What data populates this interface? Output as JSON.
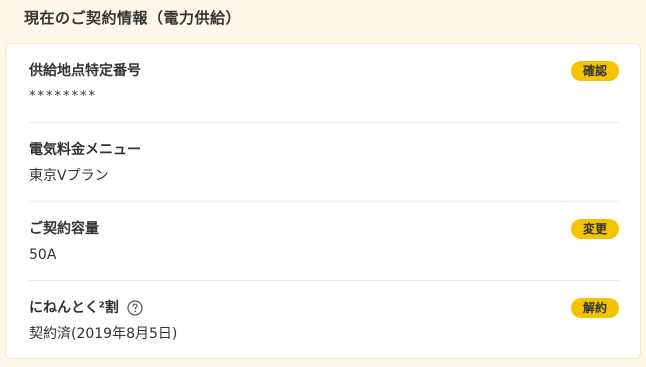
{
  "page": {
    "title": "現在のご契約情報（電力供給）"
  },
  "contract": {
    "supply_point": {
      "label": "供給地点特定番号",
      "value": "********",
      "action_label": "確認"
    },
    "menu": {
      "label": "電気料金メニュー",
      "value": "東京Vプラン"
    },
    "capacity": {
      "label": "ご契約容量",
      "value": "50A",
      "action_label": "変更"
    },
    "nennen": {
      "label": "にねんとく²割",
      "value": "契約済(2019年8月5日)",
      "action_label": "解約",
      "help_icon": "question-circle-icon"
    }
  },
  "colors": {
    "background": "#fdf8ea",
    "card": "#ffffff",
    "accent_pill": "#f5c400",
    "divider": "#ebebeb",
    "text": "#333333"
  }
}
